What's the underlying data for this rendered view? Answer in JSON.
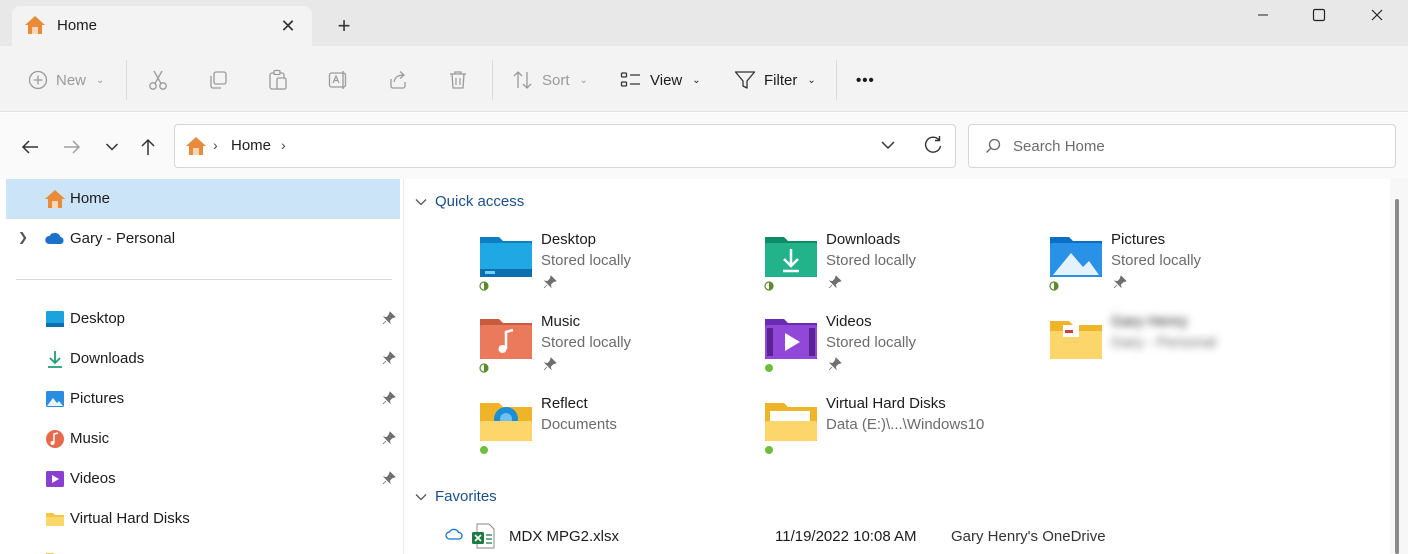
{
  "tab": {
    "title": "Home",
    "icon": "home-icon"
  },
  "commands": {
    "new": "New",
    "sort": "Sort",
    "view": "View",
    "filter": "Filter",
    "more": "•••"
  },
  "address": {
    "crumb": "Home",
    "sep": "›"
  },
  "search": {
    "placeholder": "Search Home"
  },
  "sidebar": {
    "items": [
      {
        "label": "Home",
        "icon": "home-icon",
        "selected": true
      },
      {
        "label": "Gary - Personal",
        "icon": "onedrive-cloud-icon",
        "expandable": true
      },
      {
        "label": "Desktop",
        "icon": "desktop-folder-icon",
        "pinned": true
      },
      {
        "label": "Downloads",
        "icon": "download-arrow-icon",
        "pinned": true
      },
      {
        "label": "Pictures",
        "icon": "pictures-icon",
        "pinned": true
      },
      {
        "label": "Music",
        "icon": "music-icon",
        "pinned": true
      },
      {
        "label": "Videos",
        "icon": "videos-icon",
        "pinned": true
      },
      {
        "label": "Virtual Hard Disks",
        "icon": "folder-icon"
      }
    ]
  },
  "quick_access": {
    "title": "Quick access",
    "items": [
      {
        "name": "Desktop",
        "sub": "Stored locally",
        "icon": "desktop-folder-icon",
        "pinned": true
      },
      {
        "name": "Downloads",
        "sub": "Stored locally",
        "icon": "downloads-folder-icon",
        "pinned": true
      },
      {
        "name": "Pictures",
        "sub": "Stored locally",
        "icon": "pictures-folder-icon",
        "pinned": true
      },
      {
        "name": "Music",
        "sub": "Stored locally",
        "icon": "music-folder-icon",
        "pinned": true
      },
      {
        "name": "Videos",
        "sub": "Stored locally",
        "icon": "videos-folder-icon",
        "pinned": true
      },
      {
        "name": "Gary Henry",
        "sub": "Gary - Personal",
        "icon": "folder-icon",
        "blurred": true
      },
      {
        "name": "Reflect",
        "sub": "Documents",
        "icon": "reflect-folder-icon"
      },
      {
        "name": "Virtual Hard Disks",
        "sub": "Data (E:)\\...\\Windows10",
        "icon": "folder-icon"
      }
    ]
  },
  "favorites": {
    "title": "Favorites",
    "items": [
      {
        "name": "MDX MPG2.xlsx",
        "date": "11/19/2022 10:08 AM",
        "location": "Gary Henry's OneDrive"
      }
    ]
  },
  "colors": {
    "accent": "#1a4f8c",
    "selected": "#cce4f7",
    "folder": "#f8c642"
  }
}
